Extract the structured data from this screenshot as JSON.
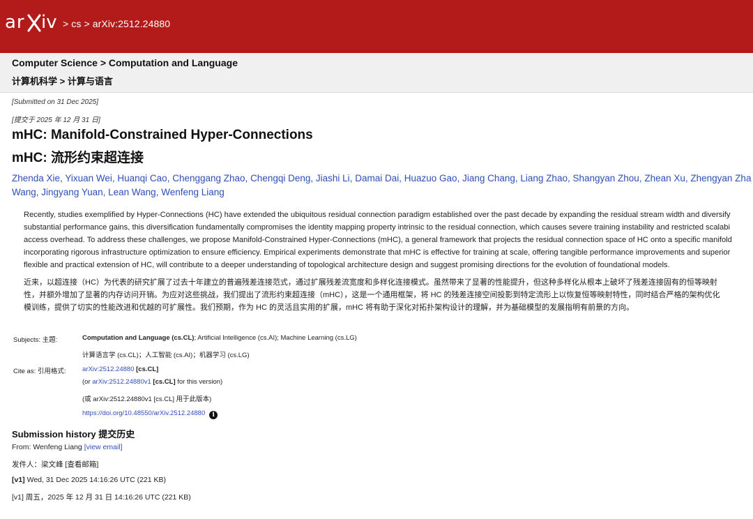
{
  "header": {
    "logo_text": "arXiv",
    "breadcrumb": [
      "cs",
      "arXiv:2512.24880"
    ],
    "separator": ">",
    "brand_color": "#b31b1b"
  },
  "category": {
    "en": "Computer Science > Computation and Language",
    "cn": "计算机科学 > 计算与语言"
  },
  "submitted": {
    "en": "[Submitted on 31 Dec 2025]",
    "cn": "[提交于 2025 年 12 月 31 日]"
  },
  "title": {
    "en": "mHC: Manifold-Constrained Hyper-Connections",
    "cn": "mHC: 流形约束超连接"
  },
  "authors": [
    "Zhenda Xie",
    "Yixuan Wei",
    "Huanqi Cao",
    "Chenggang Zhao",
    "Chengqi Deng",
    "Jiashi Li",
    "Damai Dai",
    "Huazuo Gao",
    "Jiang Chang",
    "Liang Zhao",
    "Shangyan Zhou",
    "Zhean Xu",
    "Zhengyan Zha",
    "Wang",
    "Jingyang Yuan",
    "Lean Wang",
    "Wenfeng Liang"
  ],
  "abstract_en": [
    "Recently, studies exemplified by Hyper-Connections (HC) have extended the ubiquitous residual connection paradigm established over the past decade by expanding the residual stream width and diversify",
    "substantial performance gains, this diversification fundamentally compromises the identity mapping property intrinsic to the residual connection, which causes severe training instability and restricted scalabi",
    "access overhead. To address these challenges, we propose Manifold-Constrained Hyper-Connections (mHC), a general framework that projects the residual connection space of HC onto a specific manifold",
    "incorporating rigorous infrastructure optimization to ensure efficiency. Empirical experiments demonstrate that mHC is effective for training at scale, offering tangible performance improvements and superior",
    "flexible and practical extension of HC, will contribute to a deeper understanding of topological architecture design and suggest promising directions for the evolution of foundational models."
  ],
  "abstract_cn": [
    "近来，以超连接（HC）为代表的研究扩展了过去十年建立的普遍残差连接范式，通过扩展残差流宽度和多样化连接模式。虽然带来了显著的性能提升，但这种多样化从根本上破坏了残差连接固有的恒等映射",
    "性，并额外增加了显著的内存访问开销。为应对这些挑战，我们提出了流形约束超连接（mHC），这是一个通用框架，将 HC 的残差连接空间投影到特定流形上以恢复恒等映射特性，同时结合严格的架构优化",
    "模训练，提供了切实的性能改进和优越的可扩展性。我们预期，作为 HC 的灵活且实用的扩展，mHC 将有助于深化对拓扑架构设计的理解，并为基础模型的发展指明有前景的方向。"
  ],
  "subjects": {
    "label": "Subjects:  主题:",
    "primary": "Computation and Language (cs.CL)",
    "rest": "; Artificial Intelligence (cs.AI); Machine Learning (cs.LG)",
    "cn": "计算语言学 (cs.CL)；人工智能 (cs.AI)；机器学习 (cs.LG)"
  },
  "cite": {
    "label": "Cite as:  引用格式:",
    "id_link": "arXiv:2512.24880",
    "id_suffix": " [cs.CL]",
    "version_prefix": "(or ",
    "version_link": "arXiv:2512.24880v1",
    "version_cat": " [cs.CL]",
    "version_suffix": " for this version)",
    "version_cn": "(或 arXiv:2512.24880v1 [cs.CL] 用于此版本)",
    "doi": "https://doi.org/10.48550/arXiv.2512.24880",
    "info_icon": "i"
  },
  "history": {
    "title": "Submission history  提交历史",
    "from_prefix": "From: Wenfeng Liang ",
    "view_email": "[view email]",
    "from_cn": "发件人：梁文峰 [查看邮箱]",
    "v1_tag": "[v1]",
    "v1_en": " Wed, 31 Dec 2025 14:16:26 UTC (221 KB)",
    "v1_cn": "[v1] 周五，2025 年 12 月 31 日 14:16:26 UTC (221 KB)"
  }
}
